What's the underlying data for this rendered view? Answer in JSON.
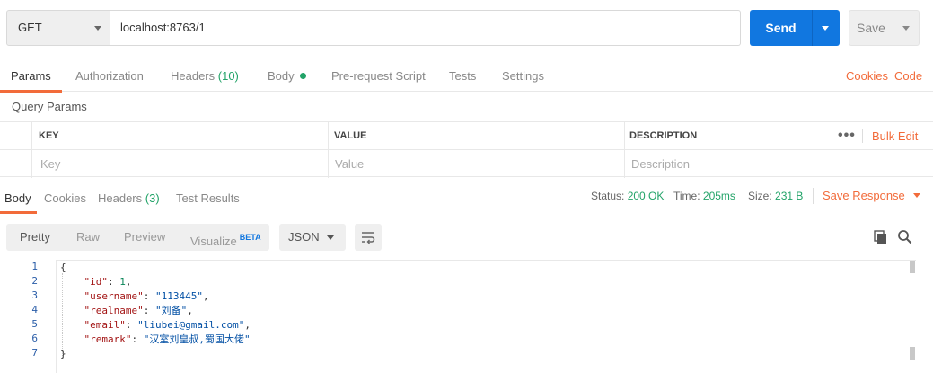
{
  "request": {
    "method": "GET",
    "url": "localhost:8763/1",
    "send_label": "Send",
    "save_label": "Save"
  },
  "request_tabs": [
    {
      "label": "Params",
      "active": true
    },
    {
      "label": "Authorization"
    },
    {
      "label": "Headers",
      "count": "(10)"
    },
    {
      "label": "Body",
      "has_dot": true
    },
    {
      "label": "Pre-request Script"
    },
    {
      "label": "Tests"
    },
    {
      "label": "Settings"
    }
  ],
  "request_links": {
    "cookies": "Cookies",
    "code": "Code"
  },
  "query_params": {
    "title": "Query Params",
    "columns": {
      "key": "KEY",
      "value": "VALUE",
      "description": "DESCRIPTION"
    },
    "placeholders": {
      "key": "Key",
      "value": "Value",
      "description": "Description"
    },
    "more_label": "•••",
    "bulk_edit": "Bulk Edit"
  },
  "response_tabs": [
    {
      "label": "Body",
      "active": true
    },
    {
      "label": "Cookies"
    },
    {
      "label": "Headers",
      "count": "(3)"
    },
    {
      "label": "Test Results"
    }
  ],
  "response_status": {
    "status_label": "Status:",
    "status_value": "200 OK",
    "time_label": "Time:",
    "time_value": "205ms",
    "size_label": "Size:",
    "size_value": "231 B",
    "save_response": "Save Response"
  },
  "view_modes": {
    "pretty": "Pretty",
    "raw": "Raw",
    "preview": "Preview",
    "visualize": "Visualize",
    "beta": "BETA"
  },
  "format": "JSON",
  "icons": {
    "copy": "copy-icon",
    "search": "search-icon",
    "wrap": "wrap-lines-icon"
  },
  "colors": {
    "accent": "#f26b3a",
    "send": "#1177e0",
    "success": "#22a368"
  },
  "code": {
    "line_numbers": [
      "1",
      "2",
      "3",
      "4",
      "5",
      "6",
      "7"
    ],
    "open_brace": "{",
    "close_brace": "}",
    "fields": [
      {
        "key": "\"id\"",
        "value": "1",
        "type": "number",
        "comma": ","
      },
      {
        "key": "\"username\"",
        "value": "\"113445\"",
        "type": "string",
        "comma": ","
      },
      {
        "key": "\"realname\"",
        "value": "\"刘备\"",
        "type": "string",
        "comma": ","
      },
      {
        "key": "\"email\"",
        "value": "\"liubei@gmail.com\"",
        "type": "string",
        "comma": ","
      },
      {
        "key": "\"remark\"",
        "value": "\"汉室刘皇叔,蜀国大佬\"",
        "type": "string",
        "comma": ""
      }
    ]
  }
}
